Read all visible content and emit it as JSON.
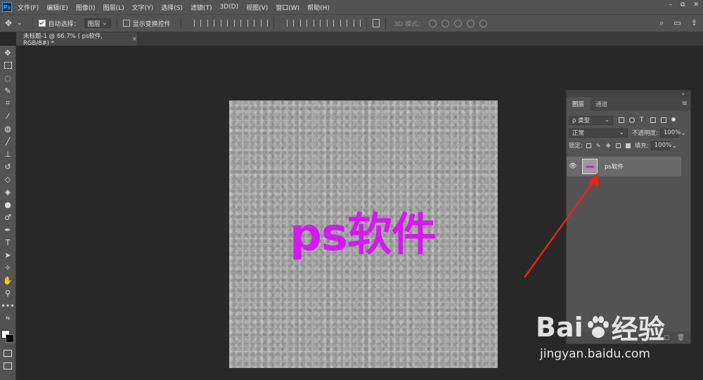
{
  "app": {
    "logo": "Ps"
  },
  "menu": {
    "items": [
      "文件(F)",
      "编辑(E)",
      "图像(I)",
      "图层(L)",
      "文字(Y)",
      "选择(S)",
      "滤镜(T)",
      "3D(D)",
      "视图(V)",
      "窗口(W)",
      "帮助(H)"
    ]
  },
  "window_controls": {
    "minimize": "–",
    "restore": "⧉",
    "close": "✕"
  },
  "options_bar": {
    "auto_select_label": "自动选择：",
    "auto_select_checked": true,
    "target_value": "图层",
    "show_transform_label": "显示变换控件",
    "show_transform_checked": false,
    "mode_3d_label": "3D 模式："
  },
  "document_tab": {
    "title": "未标题-1 @ 66.7% ( ps软件, RGB/8#) *",
    "close": "×"
  },
  "canvas": {
    "text": "ps软件",
    "text_color": "#d21bf0"
  },
  "layers_panel": {
    "tabs": [
      "图层",
      "通道"
    ],
    "active_tab": "图层",
    "filter_kind": "ρ 类型",
    "blend_mode": "正常",
    "opacity_label": "不透明度:",
    "opacity_value": "100%",
    "lock_label": "锁定:",
    "fill_label": "填充:",
    "fill_value": "100%",
    "layers": [
      {
        "name": "ps软件",
        "visible": true
      }
    ]
  },
  "watermark": {
    "brand_left": "Bai",
    "brand_right": "经验",
    "url": "jingyan.baidu.com"
  }
}
